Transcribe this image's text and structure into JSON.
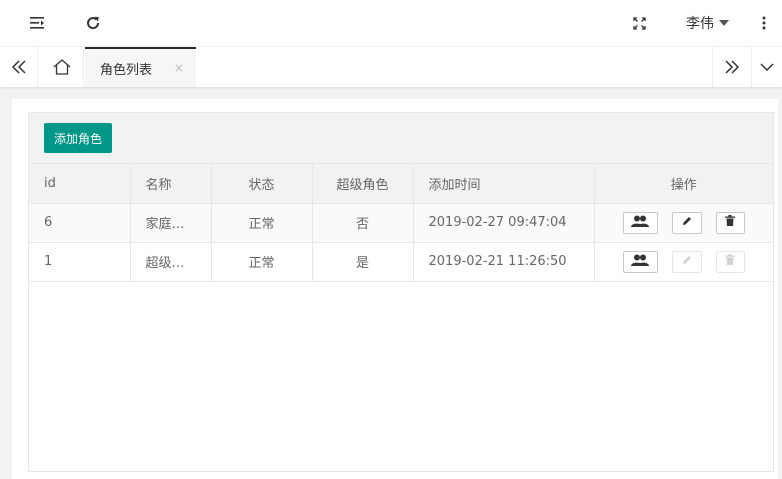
{
  "header": {
    "icons": {
      "menu": "menu-fold-icon",
      "refresh": "refresh-icon",
      "fullscreen": "fullscreen-icon",
      "more": "more-vertical-icon"
    },
    "user_name": "李伟"
  },
  "tabbar": {
    "active_tab": "角色列表",
    "close_glyph": "×"
  },
  "toolbar": {
    "add_label": "添加角色",
    "add_color": "#009688"
  },
  "table": {
    "columns": [
      "id",
      "名称",
      "状态",
      "超级角色",
      "添加时间",
      "操作"
    ],
    "rows": [
      {
        "id": "6",
        "name": "家庭…",
        "status": "正常",
        "super": "否",
        "time": "2019-02-27 09:47:04",
        "edit_enabled": true
      },
      {
        "id": "1",
        "name": "超级…",
        "status": "正常",
        "super": "是",
        "time": "2019-02-21 11:26:50",
        "edit_enabled": false
      }
    ]
  }
}
